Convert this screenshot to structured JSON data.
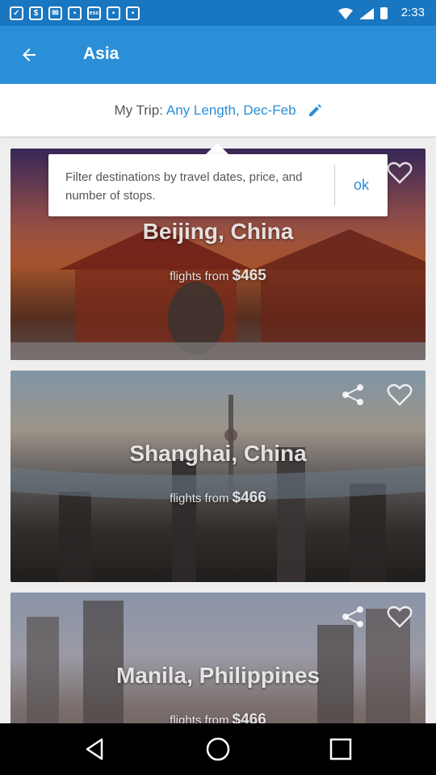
{
  "status_bar": {
    "time": "2:33"
  },
  "app_bar": {
    "title": "Asia"
  },
  "trip": {
    "label": "My Trip:",
    "value": "Any Length, Dec-Feb"
  },
  "tooltip": {
    "text": "Filter destinations by travel dates, price, and number of stops.",
    "ok_label": "ok"
  },
  "cards": [
    {
      "city": "Beijing, China",
      "price_prefix": "flights from",
      "price": "$465"
    },
    {
      "city": "Shanghai, China",
      "price_prefix": "flights from",
      "price": "$466"
    },
    {
      "city": "Manila, Philippines",
      "price_prefix": "flights from",
      "price": "$466"
    }
  ],
  "colors": {
    "primary": "#2b8fd8",
    "status_bar": "#1976c0"
  },
  "icons": [
    "arrow-back-icon",
    "edit-pencil-icon",
    "share-icon",
    "heart-icon",
    "nav-back-icon",
    "nav-home-icon",
    "nav-recents-icon"
  ]
}
